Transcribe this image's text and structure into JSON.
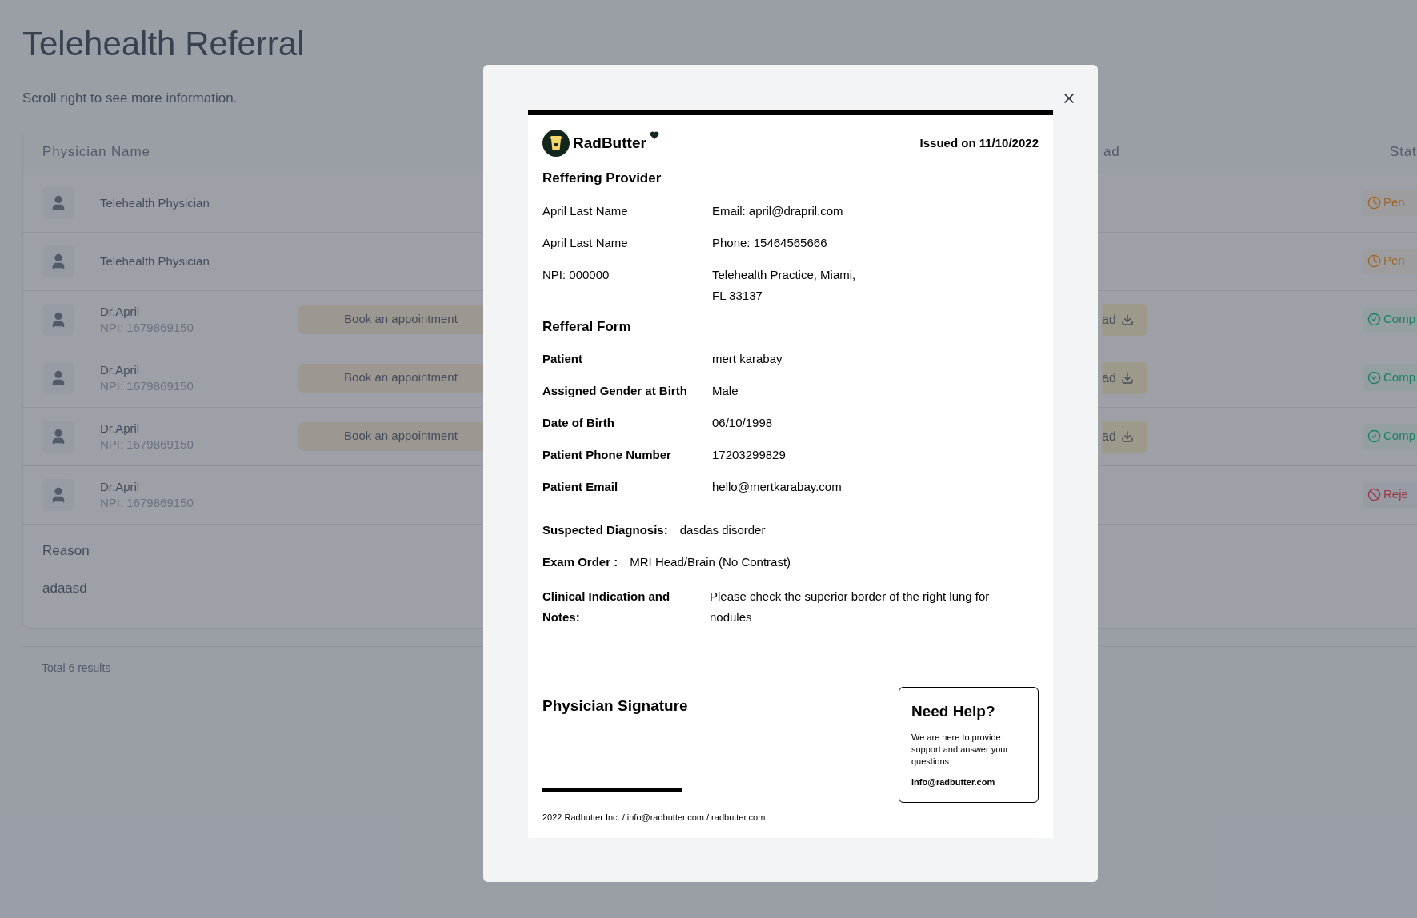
{
  "page": {
    "title": "Telehealth Referral",
    "subtitle": "Scroll right to see more information."
  },
  "table": {
    "columns": [
      "Physician Name",
      "ad",
      "Stat"
    ],
    "rows": [
      {
        "name": "Telehealth Physician",
        "status": {
          "kind": "pending",
          "label": "Pen"
        }
      },
      {
        "name": "Telehealth Physician",
        "status": {
          "kind": "pending",
          "label": "Pen"
        }
      },
      {
        "name": "Dr.April",
        "npi": "NPI: 1679869150",
        "book": "Book an appointment",
        "download": "ad",
        "status": {
          "kind": "completed",
          "label": "Comp"
        }
      },
      {
        "name": "Dr.April",
        "npi": "NPI: 1679869150",
        "book": "Book an appointment",
        "download": "ad",
        "status": {
          "kind": "completed",
          "label": "Comp"
        }
      },
      {
        "name": "Dr.April",
        "npi": "NPI: 1679869150",
        "book": "Book an appointment",
        "download": "ad",
        "status": {
          "kind": "completed",
          "label": "Comp"
        }
      },
      {
        "name": "Dr.April",
        "npi": "NPI: 1679869150",
        "status": {
          "kind": "rejected",
          "label": "Reje"
        }
      }
    ],
    "reason": {
      "label": "Reason",
      "value": "adaasd"
    },
    "total": "Total 6 results"
  },
  "document": {
    "brand": "RadButter",
    "issued": "Issued on 11/10/2022",
    "provider_title": "Reffering Provider",
    "provider_rows": [
      {
        "left": "April Last Name",
        "right": "Email: april@drapril.com"
      },
      {
        "left": "April Last Name",
        "right": "Phone: 15464565666"
      },
      {
        "left": "NPI: 000000",
        "right": "Telehealth Practice, Miami, FL 33137"
      }
    ],
    "form_title": "Refferal Form",
    "form_rows": [
      {
        "label": "Patient",
        "value": "mert karabay"
      },
      {
        "label": "Assigned Gender at Birth",
        "value": "Male"
      },
      {
        "label": "Date of Birth",
        "value": "06/10/1998"
      },
      {
        "label": "Patient Phone Number",
        "value": "17203299829"
      },
      {
        "label": "Patient Email",
        "value": "hello@mertkarabay.com"
      }
    ],
    "diagnosis": {
      "label": "Suspected Diagnosis:",
      "value": "dasdas disorder"
    },
    "exam": {
      "label": "Exam Order :",
      "value": "MRI Head/Brain (No Contrast)"
    },
    "notes": {
      "label": "Clinical Indication and Notes:",
      "value": "Please check the superior border of the right lung for nodules"
    },
    "signature_title": "Physician Signature",
    "help": {
      "title": "Need Help?",
      "text": "We are here to provide support and answer your questions",
      "email": "info@radbutter.com"
    },
    "footer": "2022 Radbutter Inc. / info@radbutter.com / radbutter.com"
  }
}
